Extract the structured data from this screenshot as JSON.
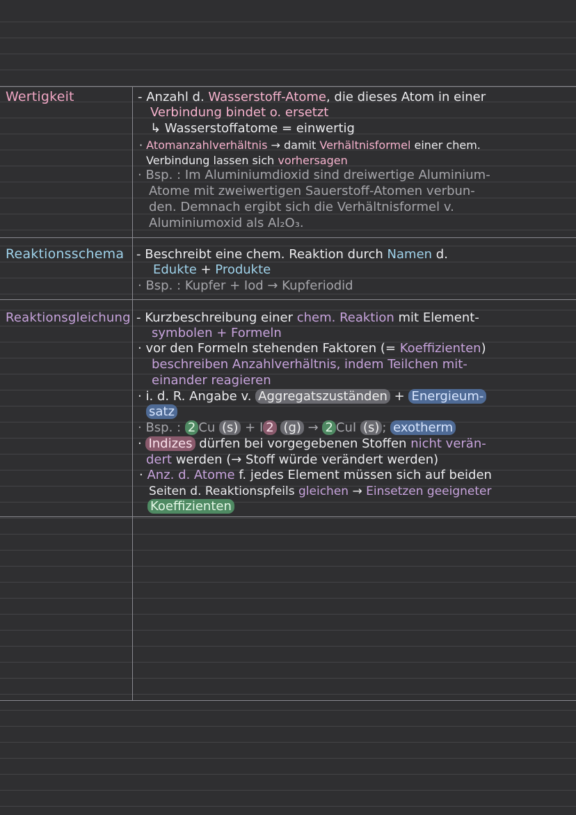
{
  "rows": [
    {
      "term": "Wertigkeit",
      "lines": [
        [
          "- Anzahl d. ",
          "Wasserstoff-Atome",
          ", die dieses Atom in einer"
        ],
        [
          "Verbindung bindet o. ersetzt"
        ],
        [
          "↳ Wasserstoffatome = einwertig"
        ],
        [
          "· ",
          "Atomanzahlverhältnis",
          " → damit ",
          "Verhältnisformel",
          " einer chem."
        ],
        [
          "Verbindung lassen sich ",
          "vorhersagen"
        ],
        [
          "· Bsp. : Im Aluminiumdioxid sind dreiwertige Aluminium-"
        ],
        [
          "Atome mit zweiwertigen Sauerstoff-Atomen verbun-"
        ],
        [
          "den. Demnach ergibt sich die Verhältnisformel v."
        ],
        [
          "Aluminiumoxid als Al₂O₃."
        ]
      ]
    },
    {
      "term": "Reaktionsschema",
      "lines": [
        [
          "- Beschreibt eine chem. Reaktion durch ",
          "Namen",
          " d."
        ],
        [
          "Edukte",
          " + ",
          "Produkte"
        ],
        [
          "· Bsp. : Kupfer + Iod → Kupferiodid"
        ]
      ]
    },
    {
      "term": "Reaktionsgleichung",
      "lines": [
        [
          "- Kurzbeschreibung einer ",
          "chem. Reaktion",
          " mit Element-"
        ],
        [
          "symbolen + Formeln"
        ],
        [
          "· vor den Formeln stehenden Faktoren (= ",
          "Koeffizienten",
          ")"
        ],
        [
          "beschreiben Anzahlverhältnis, indem ",
          "Teilchen",
          " mit-"
        ],
        [
          "einander reagieren"
        ],
        [
          "· i. d. R. Angabe v. ",
          "Aggregatszuständen",
          " + ",
          "Energieum-"
        ],
        [
          "satz"
        ],
        [
          "· Bsp. : ",
          "2",
          "Cu ",
          "(s)",
          " + I",
          "2",
          " ",
          "(g)",
          " → ",
          "2",
          "CuI ",
          "(s)",
          "; ",
          "exotherm"
        ],
        [
          "· ",
          "Indizes",
          " dürfen bei vorgegebenen Stoffen ",
          "nicht verän-"
        ],
        [
          "dert",
          " werden (→ Stoff würde verändert werden)"
        ],
        [
          "· ",
          "Anz. d. Atome",
          " f. jedes Element müssen sich auf beiden"
        ],
        [
          "Seiten d. Reaktionspfeils ",
          "gleichen",
          " → ",
          "Einsetzen geeigneter"
        ],
        [
          "Koeffizienten"
        ]
      ]
    }
  ],
  "colors": {
    "background": "#2f2f31",
    "rule": "#444447",
    "divider": "#8a8a90",
    "pink": "#f0a6c4",
    "blue": "#9fd2ea",
    "purple": "#c7a3dc",
    "highlight_blue": "#4f6b96",
    "highlight_green": "#4f8a63",
    "highlight_pink": "#8a5a6c"
  }
}
